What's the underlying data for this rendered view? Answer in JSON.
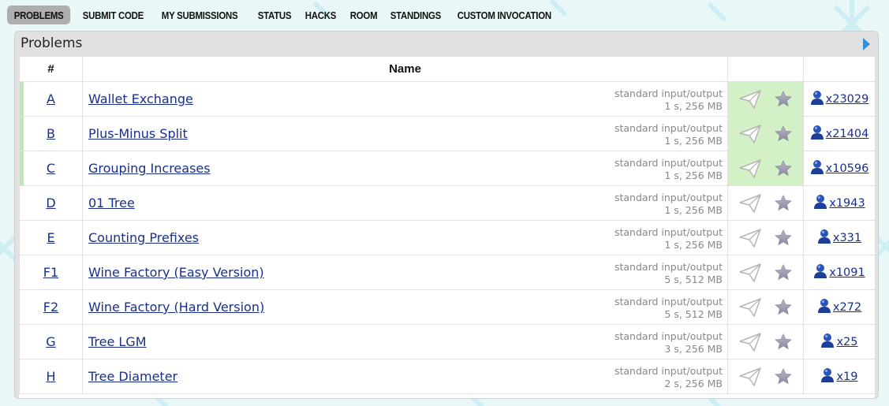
{
  "menu": {
    "items": [
      {
        "label": "PROBLEMS",
        "active": true
      },
      {
        "label": "SUBMIT CODE",
        "active": false
      },
      {
        "label": "MY SUBMISSIONS",
        "active": false
      },
      {
        "label": "STATUS",
        "active": false
      },
      {
        "label": "HACKS",
        "active": false
      },
      {
        "label": "ROOM",
        "active": false
      },
      {
        "label": "STANDINGS",
        "active": false
      },
      {
        "label": "CUSTOM INVOCATION",
        "active": false
      }
    ]
  },
  "panel": {
    "title": "Problems"
  },
  "table": {
    "headers": {
      "index": "#",
      "name": "Name"
    },
    "rows": [
      {
        "id": "A",
        "name": "Wallet Exchange",
        "io": "standard input/output",
        "limits": "1 s, 256 MB",
        "solved": "x23029",
        "accepted": true
      },
      {
        "id": "B",
        "name": "Plus-Minus Split",
        "io": "standard input/output",
        "limits": "1 s, 256 MB",
        "solved": "x21404",
        "accepted": true
      },
      {
        "id": "C",
        "name": "Grouping Increases",
        "io": "standard input/output",
        "limits": "1 s, 256 MB",
        "solved": "x10596",
        "accepted": true
      },
      {
        "id": "D",
        "name": "01 Tree",
        "io": "standard input/output",
        "limits": "1 s, 256 MB",
        "solved": "x1943",
        "accepted": false
      },
      {
        "id": "E",
        "name": "Counting Prefixes",
        "io": "standard input/output",
        "limits": "1 s, 256 MB",
        "solved": "x331",
        "accepted": false
      },
      {
        "id": "F1",
        "name": "Wine Factory (Easy Version)",
        "io": "standard input/output",
        "limits": "5 s, 512 MB",
        "solved": "x1091",
        "accepted": false
      },
      {
        "id": "F2",
        "name": "Wine Factory (Hard Version)",
        "io": "standard input/output",
        "limits": "5 s, 512 MB",
        "solved": "x272",
        "accepted": false
      },
      {
        "id": "G",
        "name": "Tree LGM",
        "io": "standard input/output",
        "limits": "3 s, 256 MB",
        "solved": "x25",
        "accepted": false
      },
      {
        "id": "H",
        "name": "Tree Diameter",
        "io": "standard input/output",
        "limits": "2 s, 256 MB",
        "solved": "x19",
        "accepted": false
      }
    ]
  },
  "icons": {
    "submit": "paper-plane-icon",
    "favorite": "star-icon",
    "solvers": "user-icon",
    "next": "arrow-right-icon"
  },
  "colors": {
    "accepted_bg": "#d4f0c7",
    "accepted_bar": "#bde9b1",
    "link": "#1a2f8a",
    "active_tab": "#aeaeae"
  }
}
